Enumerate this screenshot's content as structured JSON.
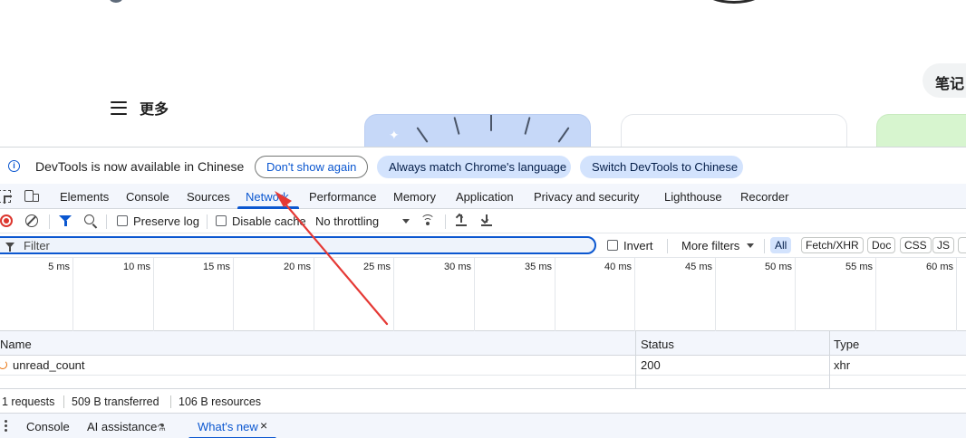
{
  "page": {
    "more_label": "更多",
    "notes_label": "笔记"
  },
  "infobar": {
    "message": "DevTools is now available in Chinese",
    "dont_show_again": "Don't show again",
    "always_match": "Always match Chrome's language",
    "switch_chinese": "Switch DevTools to Chinese"
  },
  "tabs": [
    "Elements",
    "Console",
    "Sources",
    "Network",
    "Performance",
    "Memory",
    "Application",
    "Privacy and security",
    "Lighthouse",
    "Recorder"
  ],
  "active_tab": "Network",
  "toolbar": {
    "preserve_log": "Preserve log",
    "disable_cache": "Disable cache",
    "throttling": "No throttling"
  },
  "filter": {
    "placeholder": "Filter",
    "invert": "Invert",
    "more_filters": "More filters",
    "types": [
      "All",
      "Fetch/XHR",
      "Doc",
      "CSS",
      "JS"
    ],
    "active_type": "All"
  },
  "timeline": {
    "ticks": [
      "5 ms",
      "10 ms",
      "15 ms",
      "20 ms",
      "25 ms",
      "30 ms",
      "35 ms",
      "40 ms",
      "45 ms",
      "50 ms",
      "55 ms",
      "60 ms"
    ]
  },
  "table": {
    "columns": [
      "Name",
      "Status",
      "Type"
    ],
    "rows": [
      {
        "name": "unread_count",
        "status": "200",
        "type": "xhr"
      }
    ]
  },
  "summary": {
    "requests": "1 requests",
    "transferred": "509 B transferred",
    "resources": "106 B resources"
  },
  "drawer": {
    "console": "Console",
    "ai_assistance": "AI assistance",
    "whats_new": "What's new"
  },
  "colors": {
    "accent": "#0b57d0",
    "tonal": "#d3e3fd",
    "record": "#dc362e",
    "annotation": "#e53935"
  }
}
